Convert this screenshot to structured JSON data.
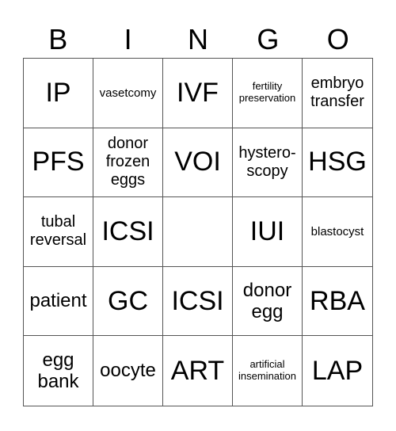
{
  "header": {
    "letters": [
      "B",
      "I",
      "N",
      "G",
      "O"
    ]
  },
  "cells": [
    {
      "text": "IP",
      "size": "xl"
    },
    {
      "text": "vasetcomy",
      "size": "s"
    },
    {
      "text": "IVF",
      "size": "xl"
    },
    {
      "text": "fertility preservation",
      "size": "xs"
    },
    {
      "text": "embryo transfer",
      "size": "m"
    },
    {
      "text": "PFS",
      "size": "xl"
    },
    {
      "text": "donor frozen eggs",
      "size": "m"
    },
    {
      "text": "VOI",
      "size": "xl"
    },
    {
      "text": "hystero-scopy",
      "size": "m"
    },
    {
      "text": "HSG",
      "size": "xl"
    },
    {
      "text": "tubal reversal",
      "size": "m"
    },
    {
      "text": "ICSI",
      "size": "xl"
    },
    {
      "text": "",
      "size": "xl"
    },
    {
      "text": "IUI",
      "size": "xl"
    },
    {
      "text": "blastocyst",
      "size": "s"
    },
    {
      "text": "patient",
      "size": "l"
    },
    {
      "text": "GC",
      "size": "xl"
    },
    {
      "text": "ICSI",
      "size": "xl"
    },
    {
      "text": "donor egg",
      "size": "l"
    },
    {
      "text": "RBA",
      "size": "xl"
    },
    {
      "text": "egg bank",
      "size": "l"
    },
    {
      "text": "oocyte",
      "size": "l"
    },
    {
      "text": "ART",
      "size": "xl"
    },
    {
      "text": "artificial insemination",
      "size": "xs"
    },
    {
      "text": "LAP",
      "size": "xl"
    }
  ]
}
